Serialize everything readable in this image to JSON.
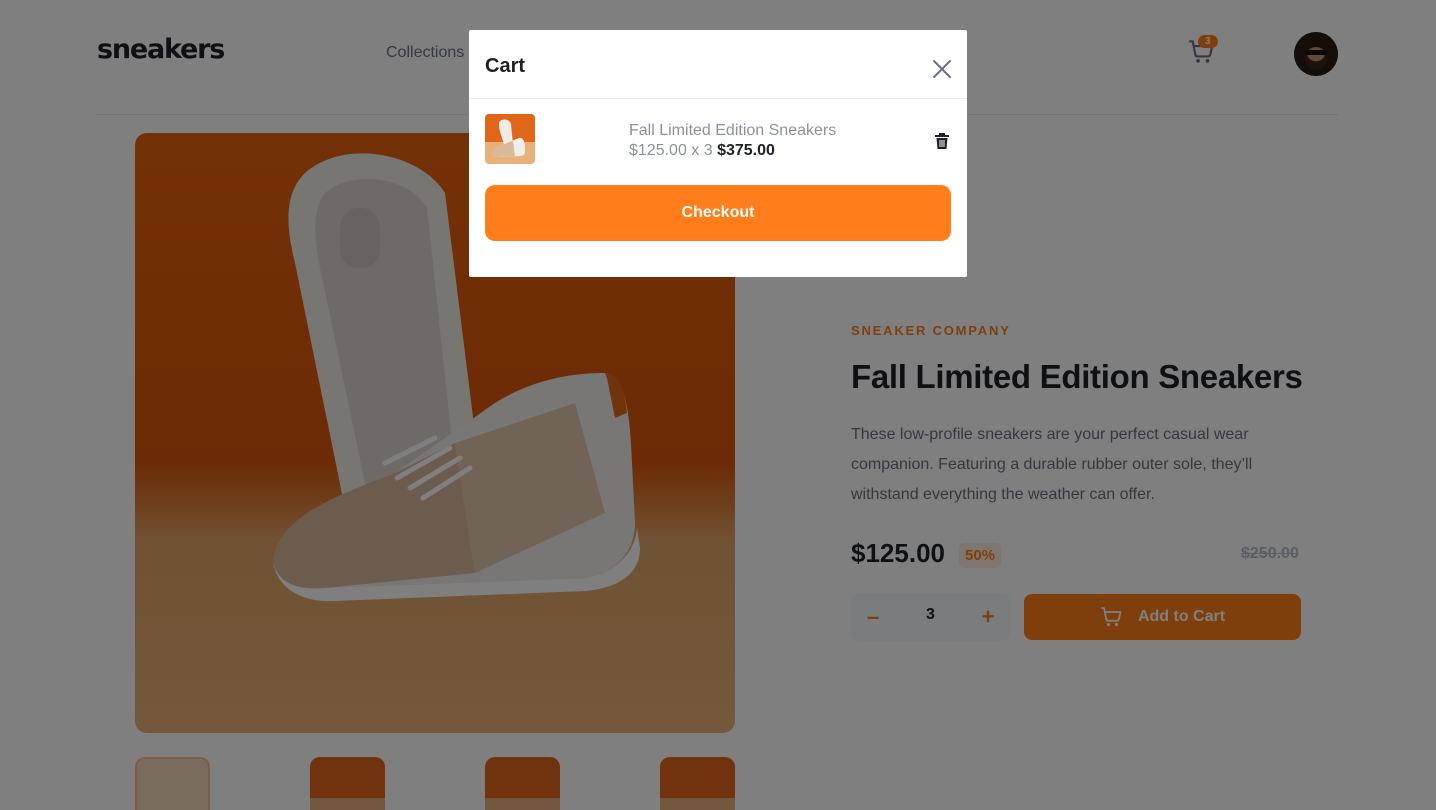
{
  "header": {
    "logo": "sneakers",
    "nav": [
      "Collections"
    ],
    "cart_count": "3",
    "icons": {
      "cart": "cart-icon",
      "avatar": "avatar-image"
    }
  },
  "product": {
    "company": "SNEAKER COMPANY",
    "title": "Fall Limited Edition Sneakers",
    "description": "These low-profile sneakers are your perfect casual wear companion. Featuring a durable rubber outer sole, they’ll withstand everything the weather can offer.",
    "price": "$125.00",
    "discount": "50%",
    "original_price": "$250.00",
    "quantity": "3",
    "minus_label": "–",
    "plus_label": "+",
    "add_to_cart_label": "Add to Cart"
  },
  "cart": {
    "title": "Cart",
    "item": {
      "name": "Fall Limited Edition Sneakers",
      "unit_price_qty": "$125.00 x 3",
      "total": "$375.00"
    },
    "checkout_label": "Checkout"
  },
  "colors": {
    "accent": "#ff7e1b",
    "accent_pale": "#ffede0",
    "text_dark": "#1d2026",
    "text_gray": "#69707d",
    "overlay": "rgba(0,0,0,0.5)"
  }
}
